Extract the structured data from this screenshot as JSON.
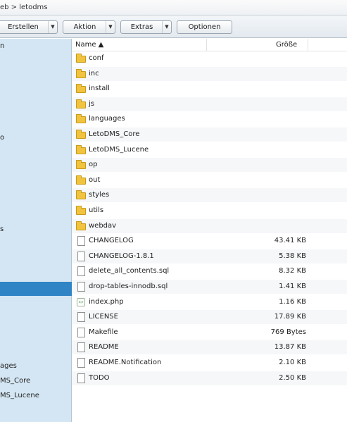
{
  "pathbar": {
    "text": "eb > letodms"
  },
  "toolbar": {
    "erstellen": "Erstellen",
    "aktion": "Aktion",
    "extras": "Extras",
    "optionen": "Optionen"
  },
  "sidebar": {
    "items": [
      "n",
      "o",
      "s",
      "",
      "ages",
      "MS_Core",
      "MS_Lucene"
    ]
  },
  "columns": {
    "name": "Name ▲",
    "size": "Größe"
  },
  "files": [
    {
      "name": "conf",
      "size": "",
      "type": "folder"
    },
    {
      "name": "inc",
      "size": "",
      "type": "folder"
    },
    {
      "name": "install",
      "size": "",
      "type": "folder"
    },
    {
      "name": "js",
      "size": "",
      "type": "folder"
    },
    {
      "name": "languages",
      "size": "",
      "type": "folder"
    },
    {
      "name": "LetoDMS_Core",
      "size": "",
      "type": "folder"
    },
    {
      "name": "LetoDMS_Lucene",
      "size": "",
      "type": "folder"
    },
    {
      "name": "op",
      "size": "",
      "type": "folder"
    },
    {
      "name": "out",
      "size": "",
      "type": "folder"
    },
    {
      "name": "styles",
      "size": "",
      "type": "folder"
    },
    {
      "name": "utils",
      "size": "",
      "type": "folder"
    },
    {
      "name": "webdav",
      "size": "",
      "type": "folder"
    },
    {
      "name": "CHANGELOG",
      "size": "43.41 KB",
      "type": "file"
    },
    {
      "name": "CHANGELOG-1.8.1",
      "size": "5.38 KB",
      "type": "file"
    },
    {
      "name": "delete_all_contents.sql",
      "size": "8.32 KB",
      "type": "file"
    },
    {
      "name": "drop-tables-innodb.sql",
      "size": "1.41 KB",
      "type": "file"
    },
    {
      "name": "index.php",
      "size": "1.16 KB",
      "type": "php"
    },
    {
      "name": "LICENSE",
      "size": "17.89 KB",
      "type": "file"
    },
    {
      "name": "Makefile",
      "size": "769 Bytes",
      "type": "file"
    },
    {
      "name": "README",
      "size": "13.87 KB",
      "type": "file"
    },
    {
      "name": "README.Notification",
      "size": "2.10 KB",
      "type": "file"
    },
    {
      "name": "TODO",
      "size": "2.50 KB",
      "type": "file"
    }
  ]
}
